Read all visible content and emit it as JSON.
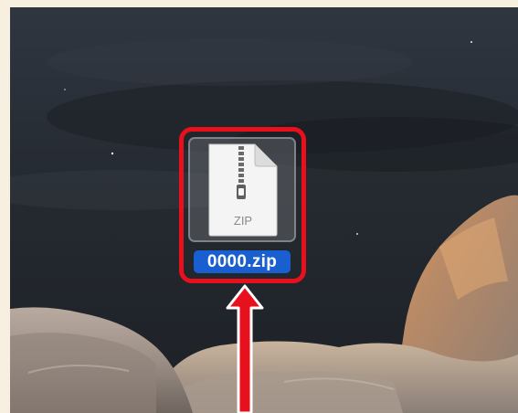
{
  "desktop": {
    "file": {
      "name": "0000.zip",
      "icon": "zip-file-icon",
      "icon_label": "ZIP"
    },
    "annotation": {
      "highlight_color": "#e8101c",
      "arrow_color": "#e8101c"
    },
    "selection_color": "#1a5fcf"
  }
}
